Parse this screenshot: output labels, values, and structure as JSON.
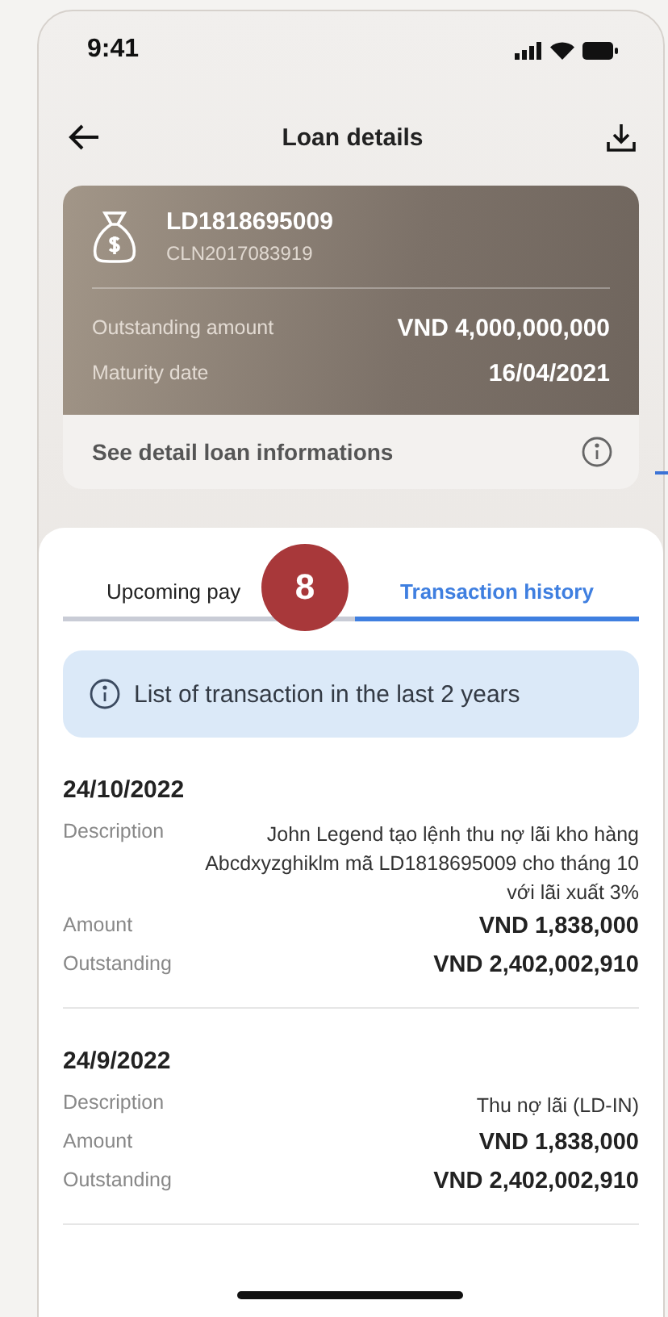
{
  "status_bar": {
    "time": "9:41"
  },
  "header": {
    "title": "Loan details"
  },
  "loan_card": {
    "loan_id": "LD1818695009",
    "contract_id": "CLN2017083919",
    "fields": [
      {
        "label": "Outstanding amount",
        "value": "VND 4,000,000,000"
      },
      {
        "label": "Maturity date",
        "value": "16/04/2021"
      }
    ],
    "link": "See detail loan informations"
  },
  "tabs": [
    {
      "label": "Upcoming pay",
      "selected": false
    },
    {
      "label": "Transaction history",
      "selected": true
    }
  ],
  "annotation": {
    "number": "8"
  },
  "notice": "List of transaction in the last 2 years",
  "transactions": [
    {
      "date": "24/10/2022",
      "rows": [
        {
          "kind": "text",
          "label": "Description",
          "value": "John Legend tạo lệnh thu nợ lãi kho hàng Abcdxyzghiklm mã LD1818695009 cho tháng 10 với lãi xuất 3%"
        },
        {
          "kind": "amount",
          "label": "Amount",
          "value": "VND 1,838,000"
        },
        {
          "kind": "amount",
          "label": "Outstanding",
          "value": "VND 2,402,002,910"
        }
      ]
    },
    {
      "date": "24/9/2022",
      "rows": [
        {
          "kind": "text",
          "label": "Description",
          "value": "Thu nợ lãi (LD-IN)"
        },
        {
          "kind": "amount",
          "label": "Amount",
          "value": "VND 1,838,000"
        },
        {
          "kind": "amount",
          "label": "Outstanding",
          "value": "VND 2,402,002,910"
        }
      ]
    }
  ]
}
